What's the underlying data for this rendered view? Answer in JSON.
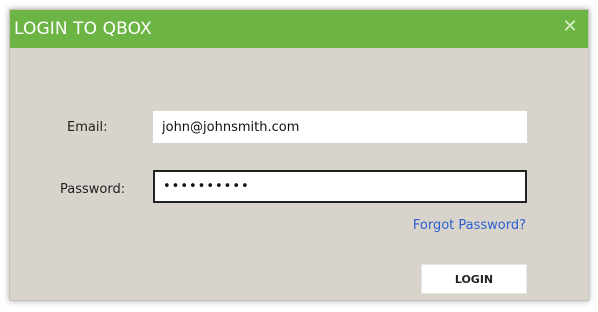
{
  "dialog": {
    "title": "LOGIN TO QBOX",
    "close_glyph": "✕",
    "accent_color": "#6cb444",
    "background_color": "#d8d4cc"
  },
  "form": {
    "email_label": "Email:",
    "email_value": "john@johnsmith.com",
    "password_label": "Password:",
    "password_value": "••••••••••",
    "forgot_password_label": "Forgot Password?",
    "login_label": "LOGIN"
  }
}
